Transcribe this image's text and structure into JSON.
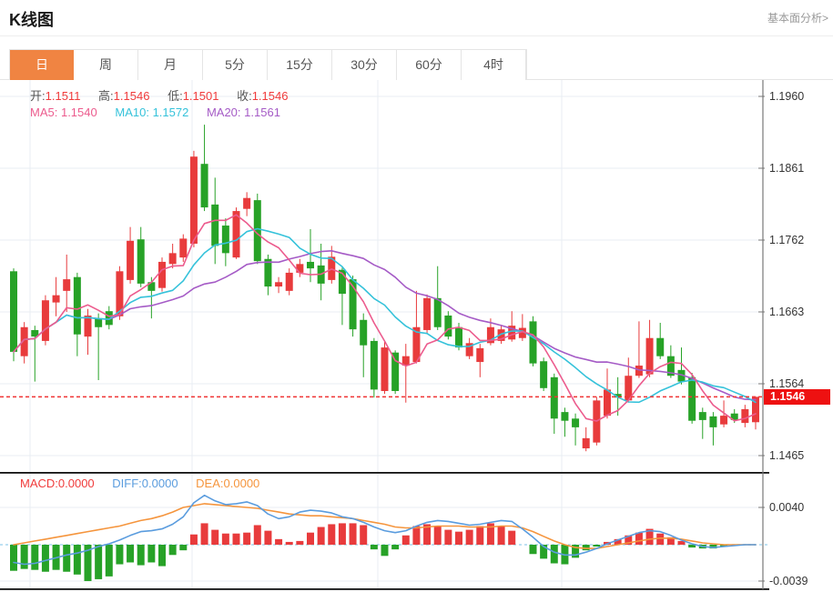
{
  "header": {
    "title": "K线图",
    "link": "基本面分析>"
  },
  "tabs": {
    "items": [
      "日",
      "周",
      "月",
      "5分",
      "15分",
      "30分",
      "60分",
      "4时"
    ],
    "active_index": 0
  },
  "colors": {
    "up_red": "#e83b3c",
    "down_green": "#27a227",
    "ma5_pink": "#ec5b8d",
    "ma10_cyan": "#35c2da",
    "ma20_purple": "#a55bc6",
    "diff_blue": "#5a9cde",
    "dea_orange": "#f5953d",
    "value_red": "#f03b3b",
    "label_gray": "#555555",
    "active_tab_orange": "#f08442",
    "price_line_red": "#f03333",
    "badge_red": "#ee1111",
    "grid": "#e9eef3",
    "axis": "#777777",
    "zero_dash_blue": "#a9d7ef",
    "separator_black": "#111111"
  },
  "main_legend": {
    "ohlc": [
      {
        "label": "开:",
        "value": "1.1511"
      },
      {
        "label": "高:",
        "value": "1.1546"
      },
      {
        "label": "低:",
        "value": "1.1501"
      },
      {
        "label": "收:",
        "value": "1.1546"
      }
    ],
    "ma": [
      {
        "label": "MA5:",
        "value": "1.1540",
        "color_key": "ma5_pink"
      },
      {
        "label": "MA10:",
        "value": "1.1572",
        "color_key": "ma10_cyan"
      },
      {
        "label": "MA20:",
        "value": "1.1561",
        "color_key": "ma20_purple"
      }
    ]
  },
  "macd_legend": [
    {
      "label": "MACD:",
      "value": "0.0000",
      "color_key": "value_red"
    },
    {
      "label": "DIFF:",
      "value": "0.0000",
      "color_key": "diff_blue"
    },
    {
      "label": "DEA:",
      "value": "0.0000",
      "color_key": "dea_orange"
    }
  ],
  "price_marker": {
    "value": "1.1546",
    "price": 1.1546
  },
  "chart_data": {
    "type": "candlestick+macd",
    "main": {
      "y_ticks": [
        1.196,
        1.1861,
        1.1762,
        1.1663,
        1.1564,
        1.1465
      ],
      "ylim": [
        1.1444,
        1.1983
      ],
      "grid_x": [
        33,
        211,
        415,
        617
      ],
      "ma_periods": [
        5,
        10,
        20
      ],
      "candles": [
        [
          1.1719,
          1.1723,
          1.1595,
          1.1608
        ],
        [
          1.1602,
          1.1649,
          1.1592,
          1.1642
        ],
        [
          1.1638,
          1.1644,
          1.1567,
          1.1629
        ],
        [
          1.1623,
          1.1686,
          1.1617,
          1.1679
        ],
        [
          1.1676,
          1.1711,
          1.1657,
          1.1686
        ],
        [
          1.1692,
          1.1742,
          1.1663,
          1.1708
        ],
        [
          1.1711,
          1.1717,
          1.1602,
          1.1632
        ],
        [
          1.1629,
          1.1667,
          1.1604,
          1.1658
        ],
        [
          1.1654,
          1.1661,
          1.1569,
          1.1642
        ],
        [
          1.1664,
          1.1671,
          1.1639,
          1.1645
        ],
        [
          1.1657,
          1.1726,
          1.1652,
          1.1719
        ],
        [
          1.1707,
          1.178,
          1.1702,
          1.1761
        ],
        [
          1.1763,
          1.178,
          1.1697,
          1.1702
        ],
        [
          1.1704,
          1.1711,
          1.1654,
          1.1692
        ],
        [
          1.1696,
          1.1738,
          1.1691,
          1.1732
        ],
        [
          1.1729,
          1.1757,
          1.1723,
          1.1744
        ],
        [
          1.1738,
          1.177,
          1.1732,
          1.1764
        ],
        [
          1.1757,
          1.1885,
          1.1752,
          1.1877
        ],
        [
          1.1867,
          1.1921,
          1.1802,
          1.1807
        ],
        [
          1.1811,
          1.1848,
          1.1729,
          1.1754
        ],
        [
          1.1782,
          1.1792,
          1.1726,
          1.1744
        ],
        [
          1.1738,
          1.1807,
          1.1736,
          1.1802
        ],
        [
          1.1805,
          1.1828,
          1.1795,
          1.182
        ],
        [
          1.1817,
          1.1826,
          1.1729,
          1.1733
        ],
        [
          1.1736,
          1.1742,
          1.1686,
          1.1698
        ],
        [
          1.1698,
          1.1711,
          1.1689,
          1.1704
        ],
        [
          1.1692,
          1.1723,
          1.1686,
          1.1717
        ],
        [
          1.1717,
          1.1736,
          1.1711,
          1.1729
        ],
        [
          1.1732,
          1.1777,
          1.1704,
          1.1723
        ],
        [
          1.1727,
          1.1757,
          1.1679,
          1.1702
        ],
        [
          1.1707,
          1.1754,
          1.1702,
          1.1739
        ],
        [
          1.1721,
          1.1724,
          1.1645,
          1.1688
        ],
        [
          1.1708,
          1.1713,
          1.1629,
          1.1639
        ],
        [
          1.1652,
          1.1661,
          1.1573,
          1.1617
        ],
        [
          1.1623,
          1.1627,
          1.1545,
          1.1556
        ],
        [
          1.1554,
          1.1623,
          1.155,
          1.1614
        ],
        [
          1.1607,
          1.161,
          1.155,
          1.1554
        ],
        [
          1.1589,
          1.1619,
          1.1538,
          1.1602
        ],
        [
          1.1594,
          1.1692,
          1.1592,
          1.1642
        ],
        [
          1.1638,
          1.1687,
          1.1633,
          1.1682
        ],
        [
          1.1682,
          1.1726,
          1.1638,
          1.1642
        ],
        [
          1.1658,
          1.1664,
          1.1625,
          1.1629
        ],
        [
          1.1642,
          1.1648,
          1.161,
          1.1614
        ],
        [
          1.1602,
          1.1627,
          1.1598,
          1.162
        ],
        [
          1.1594,
          1.1619,
          1.1573,
          1.1613
        ],
        [
          1.162,
          1.1654,
          1.1617,
          1.1642
        ],
        [
          1.1623,
          1.1645,
          1.1619,
          1.1639
        ],
        [
          1.1625,
          1.1664,
          1.1622,
          1.1644
        ],
        [
          1.1627,
          1.166,
          1.1623,
          1.1641
        ],
        [
          1.165,
          1.1657,
          1.1588,
          1.1592
        ],
        [
          1.1595,
          1.16,
          1.1554,
          1.1558
        ],
        [
          1.1573,
          1.1578,
          1.1495,
          1.1516
        ],
        [
          1.1525,
          1.1531,
          1.1491,
          1.1513
        ],
        [
          1.1516,
          1.1523,
          1.1479,
          1.1504
        ],
        [
          1.1475,
          1.1504,
          1.1471,
          1.1489
        ],
        [
          1.1483,
          1.1546,
          1.1479,
          1.1541
        ],
        [
          1.152,
          1.1585,
          1.1516,
          1.1556
        ],
        [
          1.155,
          1.1573,
          1.152,
          1.1545
        ],
        [
          1.1541,
          1.16,
          1.1538,
          1.1575
        ],
        [
          1.1575,
          1.165,
          1.1572,
          1.1589
        ],
        [
          1.1577,
          1.1652,
          1.1573,
          1.1627
        ],
        [
          1.1627,
          1.1648,
          1.1598,
          1.1602
        ],
        [
          1.1602,
          1.1617,
          1.1572,
          1.1575
        ],
        [
          1.1583,
          1.1614,
          1.1563,
          1.1567
        ],
        [
          1.1573,
          1.1579,
          1.1509,
          1.1513
        ],
        [
          1.1525,
          1.1531,
          1.1488,
          1.1514
        ],
        [
          1.1519,
          1.1525,
          1.1479,
          1.1504
        ],
        [
          1.1508,
          1.1541,
          1.1504,
          1.152
        ],
        [
          1.1523,
          1.1529,
          1.151,
          1.1514
        ],
        [
          1.151,
          1.1535,
          1.1504,
          1.1529
        ],
        [
          1.1511,
          1.1546,
          1.1501,
          1.1546
        ]
      ]
    },
    "macd": {
      "y_ticks": [
        0.004,
        -0.0039
      ],
      "ylim": [
        -0.0048,
        0.0078
      ],
      "hist": [
        -0.0028,
        -0.0026,
        -0.0027,
        -0.0029,
        -0.0027,
        -0.0029,
        -0.0032,
        -0.0039,
        -0.0037,
        -0.0034,
        -0.0021,
        -0.0019,
        -0.0022,
        -0.0019,
        -0.0023,
        -0.0011,
        -0.0006,
        0.0011,
        0.0023,
        0.0016,
        0.0012,
        0.0012,
        0.0013,
        0.0021,
        0.0015,
        0.0006,
        0.0003,
        0.0004,
        0.0013,
        0.0019,
        0.0022,
        0.0023,
        0.0023,
        0.0021,
        -0.0005,
        -0.0012,
        -0.0005,
        0.001,
        0.002,
        0.0022,
        0.002,
        0.0016,
        0.0014,
        0.0016,
        0.002,
        0.0023,
        0.002,
        0.0015,
        0.0,
        -0.001,
        -0.0015,
        -0.002,
        -0.0021,
        -0.0014,
        -0.0006,
        -0.0002,
        0.0003,
        0.0006,
        0.001,
        0.0013,
        0.0017,
        0.0012,
        0.0008,
        0.0004,
        -0.0003,
        -0.0004,
        -0.0004,
        -0.0002,
        -0.0001,
        0.0,
        0.0
      ],
      "diff": [
        -0.0019,
        -0.0021,
        -0.002,
        -0.0017,
        -0.0014,
        -0.0011,
        -0.0009,
        -0.0006,
        -0.0002,
        0.0001,
        0.0005,
        0.001,
        0.0014,
        0.0015,
        0.0017,
        0.0022,
        0.003,
        0.0045,
        0.0053,
        0.0047,
        0.0043,
        0.0044,
        0.0046,
        0.0042,
        0.0033,
        0.0028,
        0.003,
        0.0035,
        0.0037,
        0.0036,
        0.0034,
        0.003,
        0.0028,
        0.0024,
        0.0019,
        0.0015,
        0.0013,
        0.0015,
        0.002,
        0.0024,
        0.0026,
        0.0025,
        0.0023,
        0.0021,
        0.0022,
        0.0024,
        0.0026,
        0.0025,
        0.0017,
        0.0008,
        -0.0002,
        -0.0008,
        -0.0011,
        -0.0011,
        -0.0008,
        -0.0004,
        0.0001,
        0.0005,
        0.0009,
        0.0013,
        0.0015,
        0.0014,
        0.001,
        0.0005,
        0.0001,
        -0.0002,
        -0.0003,
        -0.0002,
        -0.0001,
        0.0,
        0.0
      ],
      "dea": [
        0.0,
        0.0002,
        0.0004,
        0.0006,
        0.0008,
        0.001,
        0.0012,
        0.0014,
        0.0016,
        0.0018,
        0.002,
        0.0023,
        0.0026,
        0.0028,
        0.0031,
        0.0035,
        0.004,
        0.0042,
        0.0044,
        0.0043,
        0.0042,
        0.0041,
        0.004,
        0.0039,
        0.0037,
        0.0035,
        0.0033,
        0.0032,
        0.0031,
        0.0031,
        0.003,
        0.0029,
        0.0028,
        0.0026,
        0.0024,
        0.0022,
        0.0019,
        0.0018,
        0.0018,
        0.0019,
        0.002,
        0.002,
        0.002,
        0.0019,
        0.0019,
        0.0019,
        0.002,
        0.002,
        0.0018,
        0.0014,
        0.0009,
        0.0004,
        0.0,
        -0.0003,
        -0.0004,
        -0.0004,
        -0.0002,
        0.0,
        0.0002,
        0.0004,
        0.0006,
        0.0007,
        0.0007,
        0.0006,
        0.0004,
        0.0002,
        0.0001,
        0.0,
        0.0,
        0.0,
        0.0
      ]
    }
  }
}
